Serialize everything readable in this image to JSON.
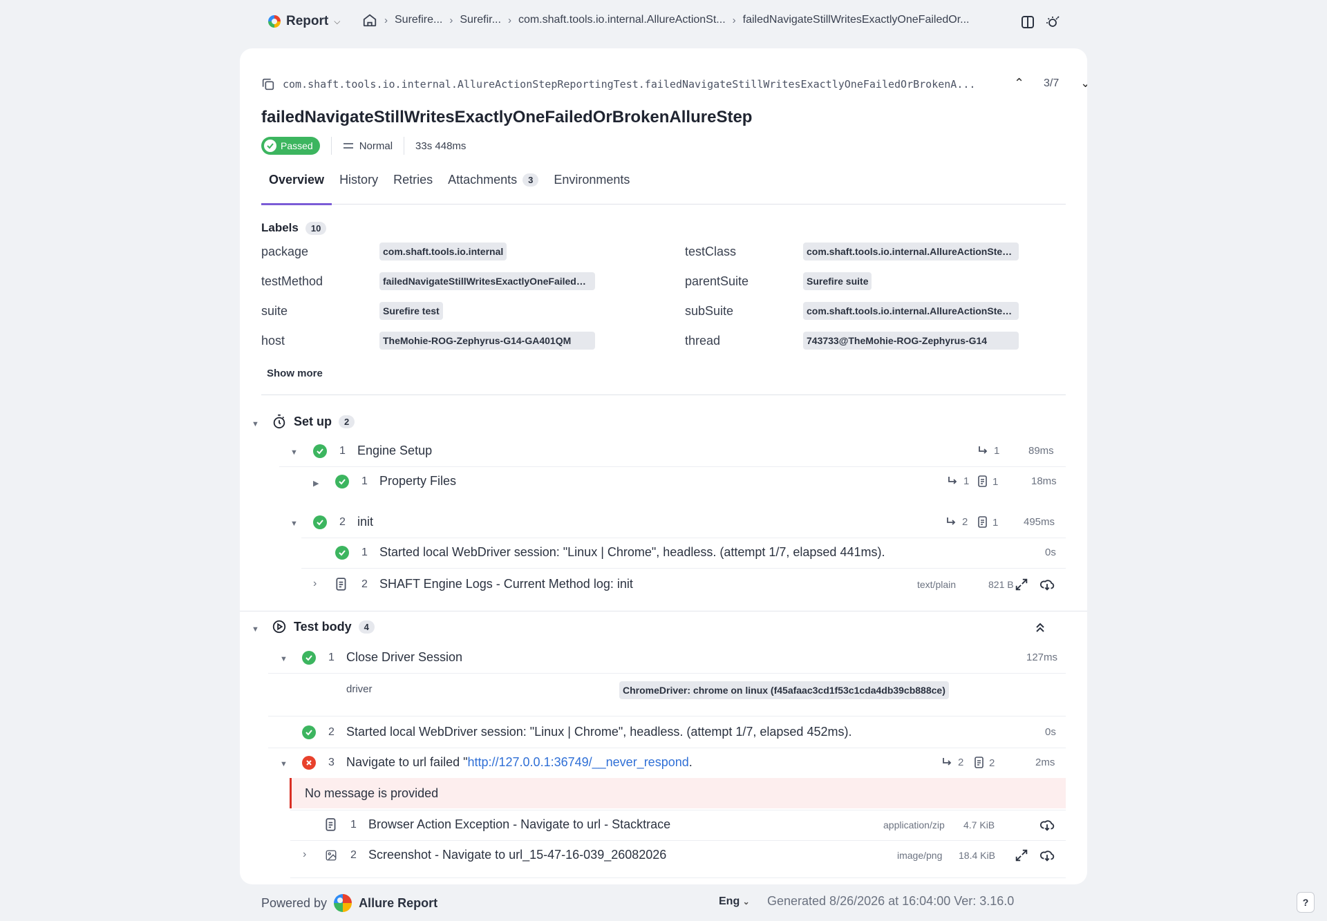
{
  "topbar": {
    "report_label": "Report",
    "breadcrumbs": [
      "Surefire...",
      "Surefir...",
      "com.shaft.tools.io.internal.AllureActionSt...",
      "failedNavigateStillWritesExactlyOneFailedOr..."
    ]
  },
  "test": {
    "full_name": "com.shaft.tools.io.internal.AllureActionStepReportingTest.failedNavigateStillWritesExactlyOneFailedOrBrokenA...",
    "counter": "3/7",
    "title": "failedNavigateStillWritesExactlyOneFailedOrBrokenAllureStep",
    "status": "Passed",
    "severity": "Normal",
    "duration": "33s 448ms"
  },
  "tabs": [
    {
      "label": "Overview"
    },
    {
      "label": "History"
    },
    {
      "label": "Retries"
    },
    {
      "label": "Attachments",
      "count": "3"
    },
    {
      "label": "Environments"
    }
  ],
  "labels": {
    "heading": "Labels",
    "count": "10",
    "show_more": "Show more",
    "items": [
      {
        "key": "package",
        "value": "com.shaft.tools.io.internal"
      },
      {
        "key": "testClass",
        "value": "com.shaft.tools.io.internal.AllureActionStepReportingTest"
      },
      {
        "key": "testMethod",
        "value": "failedNavigateStillWritesExactlyOneFailedOrBrokenAllureStep"
      },
      {
        "key": "parentSuite",
        "value": "Surefire suite"
      },
      {
        "key": "suite",
        "value": "Surefire test"
      },
      {
        "key": "subSuite",
        "value": "com.shaft.tools.io.internal.AllureActionStepReportingTest"
      },
      {
        "key": "host",
        "value": "TheMohie-ROG-Zephyrus-G14-GA401QM"
      },
      {
        "key": "thread",
        "value": "743733@TheMohie-ROG-Zephyrus-G14"
      }
    ]
  },
  "setup": {
    "heading": "Set up",
    "count": "2",
    "steps": [
      {
        "num": "1",
        "label": "Engine Setup",
        "substeps": "1",
        "duration": "89ms"
      },
      {
        "num": "1",
        "label": "Property Files",
        "substeps": "1",
        "attachments": "1",
        "duration": "18ms"
      },
      {
        "num": "2",
        "label": "init",
        "substeps": "2",
        "attachments": "1",
        "duration": "495ms"
      },
      {
        "num": "1",
        "label": "Started local WebDriver session: \"Linux | Chrome\", headless. (attempt 1/7, elapsed 441ms).",
        "duration": "0s"
      },
      {
        "num": "2",
        "label": "SHAFT Engine Logs - Current Method log: init",
        "mime": "text/plain",
        "size": "821 B"
      }
    ]
  },
  "body": {
    "heading": "Test body",
    "count": "4",
    "steps": [
      {
        "num": "1",
        "label": "Close Driver Session",
        "duration": "127ms",
        "param_key": "driver",
        "param_value": "ChromeDriver: chrome on linux (f45afaac3cd1f53c1cda4db39cb888ce)"
      },
      {
        "num": "2",
        "label": "Started local WebDriver session: \"Linux | Chrome\", headless. (attempt 1/7, elapsed 452ms).",
        "duration": "0s"
      },
      {
        "num": "3",
        "label_prefix": "Navigate to url failed \"",
        "url": "http://127.0.0.1:36749/__never_respond",
        "label_suffix": ".",
        "substeps": "2",
        "attachments": "2",
        "duration": "2ms",
        "message": "No message is provided"
      },
      {
        "num": "1",
        "label": "Browser Action Exception - Navigate to url - Stacktrace",
        "mime": "application/zip",
        "size": "4.7 KiB"
      },
      {
        "num": "2",
        "label": "Screenshot - Navigate to url_15-47-16-039_26082026",
        "mime": "image/png",
        "size": "18.4 KiB"
      }
    ]
  },
  "footer": {
    "powered_by": "Powered by",
    "brand": "Allure Report",
    "lang": "Eng",
    "generated": "Generated 8/26/2026 at 16:04:00 Ver: 3.16.0",
    "help": "?"
  },
  "colors": {
    "passed": "#3cb55f",
    "failed": "#e8412c",
    "accent": "#7b5cd6",
    "link": "#2f6fd6"
  }
}
